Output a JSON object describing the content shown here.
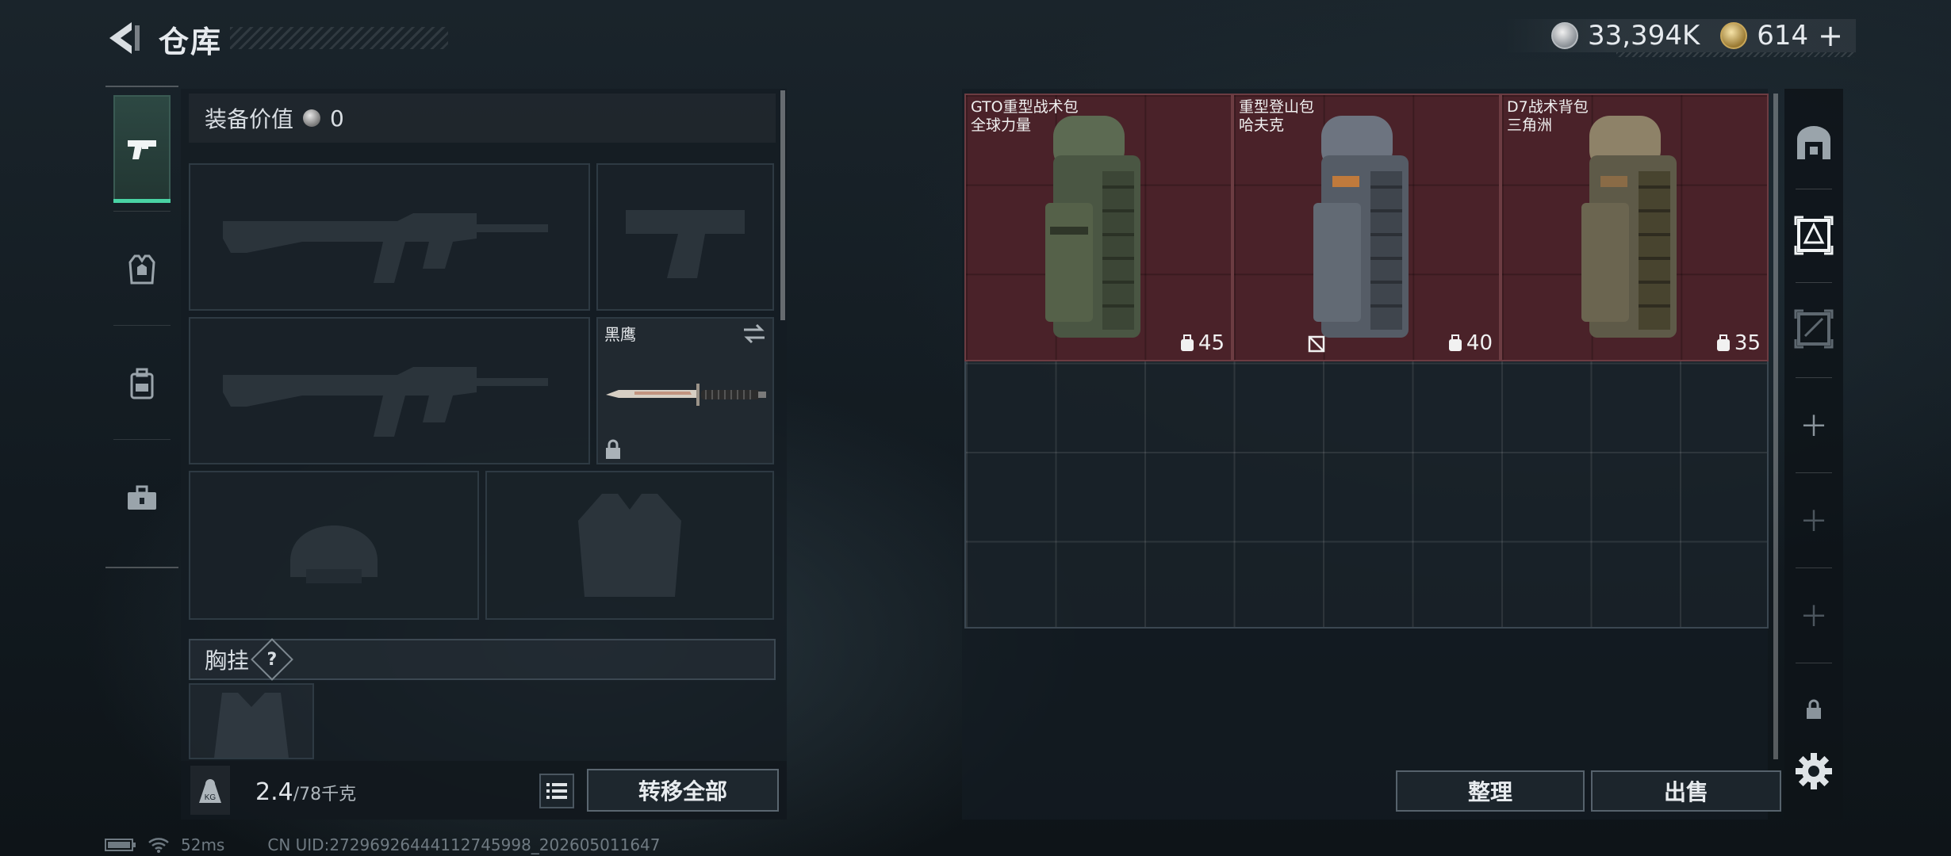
{
  "header": {
    "title": "仓库",
    "currency_silver": "33,394K",
    "currency_gold": "614",
    "plus": "+"
  },
  "equipment": {
    "value_label": "装备价值",
    "value": "0",
    "knife_name": "黑鹰",
    "chest_label": "胸挂",
    "chest_help": "?",
    "weight_current": "2.4",
    "weight_max": "/78千克",
    "transfer_all": "转移全部"
  },
  "storage": {
    "items": [
      {
        "name": "GTO重型战术包",
        "brand": "全球力量",
        "capacity": "45",
        "tint": "#5c6a52"
      },
      {
        "name": "重型登山包",
        "brand": "哈夫克",
        "capacity": "40",
        "tint": "#5f6670"
      },
      {
        "name": "D7战术背包",
        "brand": "三角洲",
        "capacity": "35",
        "tint": "#6e6651"
      }
    ],
    "sort_label": "整理",
    "sell_label": "出售"
  },
  "footer": {
    "ping": "52ms",
    "uid": "CN UID:27296926444112745998_202605011647"
  },
  "colors": {
    "accent": "#49d3a4",
    "item_bg": "#4a2229"
  }
}
